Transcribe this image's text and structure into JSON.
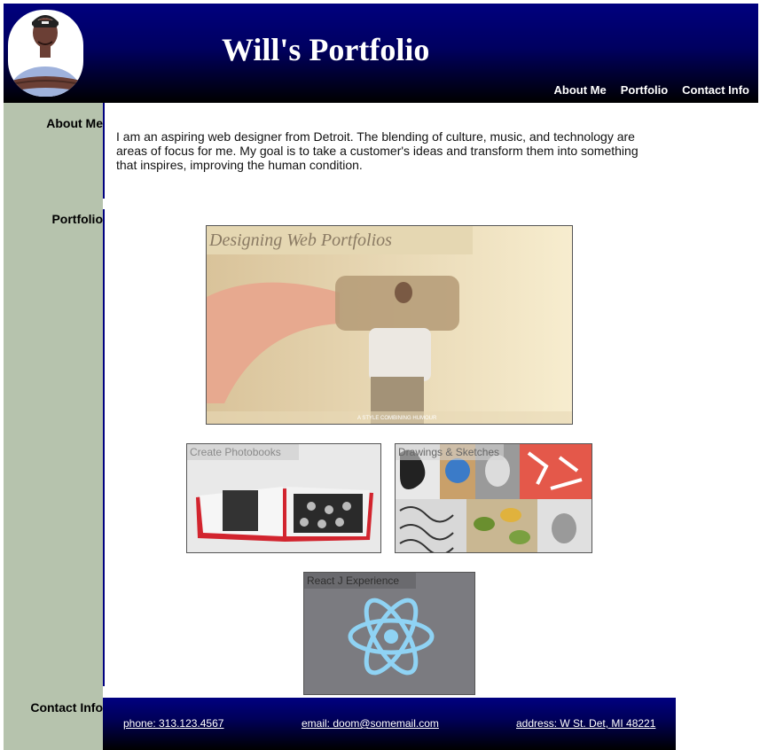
{
  "header": {
    "title": "Will's Portfolio",
    "nav": [
      "About Me",
      "Portfolio",
      "Contact Info"
    ]
  },
  "sidebar": {
    "about": "About Me",
    "portfolio": "Portfolio",
    "contact": "Contact Info"
  },
  "about": {
    "text": "I am an aspiring web designer from Detroit. The blending of culture, music, and technology are areas of focus for me. My goal is to take a customer's ideas and transform them into something that inspires, improving the human condition."
  },
  "portfolio": {
    "main": {
      "label": "Designing Web Portfolios",
      "caption": "A STYLE COMBINING HUMOUR"
    },
    "photobooks": {
      "label": "Create Photobooks"
    },
    "sketches": {
      "label": "Drawings & Sketches"
    },
    "react": {
      "label": "React J Experience"
    }
  },
  "footer": {
    "phone": "phone: 313.123.4567",
    "email": "email: doom@somemail.com",
    "address": "address: W St. Det, MI 48221"
  },
  "colors": {
    "header_blue": "#00007e",
    "sidebar_green": "#b6c3ad",
    "react_blue": "#8fd3f4",
    "react_bg": "#7b7b80"
  }
}
